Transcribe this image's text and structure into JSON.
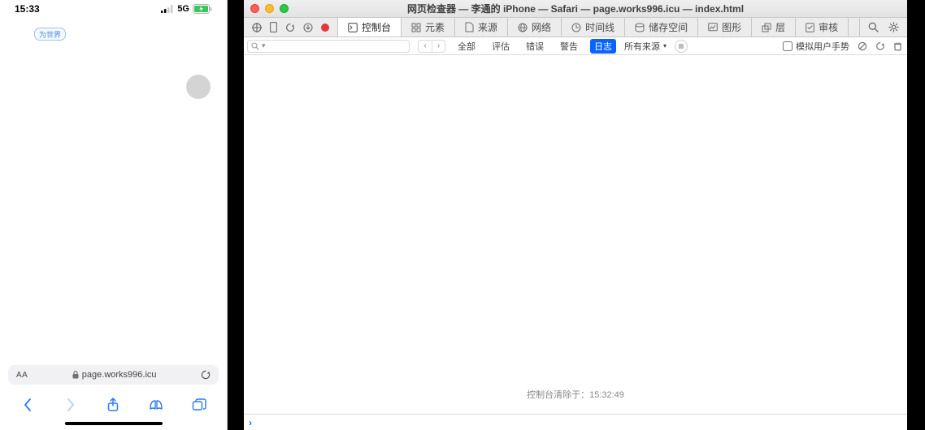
{
  "phone": {
    "status": {
      "time": "15:33",
      "network": "5G"
    },
    "chip_label": "为世界",
    "address": {
      "aa_label": "AA",
      "url_text": "page.works996.icu"
    }
  },
  "inspector": {
    "title": "网页检查器 — 李通的 iPhone — Safari — page.works996.icu — index.html",
    "tabs": {
      "console": "控制台",
      "elements": "元素",
      "sources": "来源",
      "network": "网络",
      "timelines": "时间线",
      "storage": "储存空间",
      "graphics": "图形",
      "layers": "层",
      "audit": "审核"
    },
    "filters": {
      "all": "全部",
      "eval": "评估",
      "errors": "错误",
      "warnings": "警告",
      "logs": "日志",
      "all_sources": "所有来源"
    },
    "right_toggle": "模拟用户手势",
    "cleared_text": "控制台清除于：15:32:49"
  }
}
